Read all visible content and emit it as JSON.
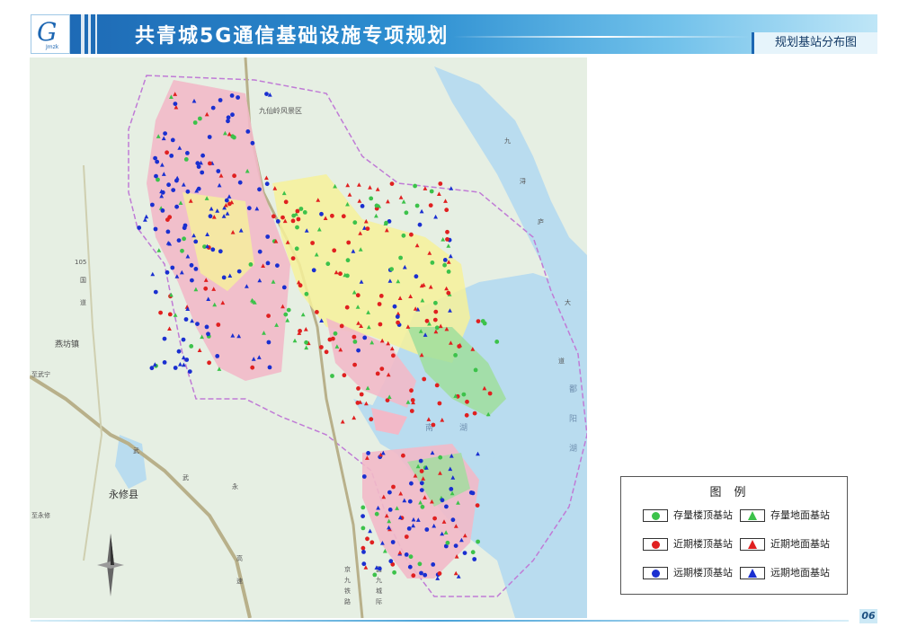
{
  "header": {
    "title": "共青城5G通信基础设施专项规划",
    "subtitle": "规划基站分布图",
    "logo_glyph": "G",
    "logo_text": "Jmzk",
    "colors": {
      "primary": "#1c66b2",
      "accent": "#6fc0ea"
    }
  },
  "map": {
    "place_labels": [
      "九仙岭风景区",
      "燕坊镇",
      "永修县",
      "至武宁",
      "至永修",
      "南",
      "湖",
      "鄱",
      "阳",
      "湖",
      "九",
      "浔",
      "庐",
      "大",
      "道",
      "京",
      "九",
      "铁",
      "路",
      "昌",
      "九",
      "城",
      "际",
      "武",
      "国",
      "道",
      "105",
      "永",
      "武",
      "高",
      "速"
    ],
    "colors": {
      "water": "#b9dcef",
      "background": "#e6efe3",
      "zone_pink": "#f2b9c8",
      "zone_yellow": "#f6f19a",
      "zone_green": "#9fde9c",
      "boundary": "#c07bd6",
      "highway": "#b8b08a"
    },
    "compass_icon": "compass-rose-icon"
  },
  "legend": {
    "title": "图例",
    "items": [
      {
        "label": "存量楼顶基站",
        "shape": "circle",
        "color": "#3cc24a"
      },
      {
        "label": "存量地面基站",
        "shape": "triangle",
        "color": "#3cc24a"
      },
      {
        "label": "近期楼顶基站",
        "shape": "circle",
        "color": "#e02020"
      },
      {
        "label": "近期地面基站",
        "shape": "triangle",
        "color": "#e02020"
      },
      {
        "label": "远期楼顶基站",
        "shape": "circle",
        "color": "#1a2fd0"
      },
      {
        "label": "远期地面基站",
        "shape": "triangle",
        "color": "#1a2fd0"
      }
    ]
  },
  "footer": {
    "page_number": "06"
  }
}
